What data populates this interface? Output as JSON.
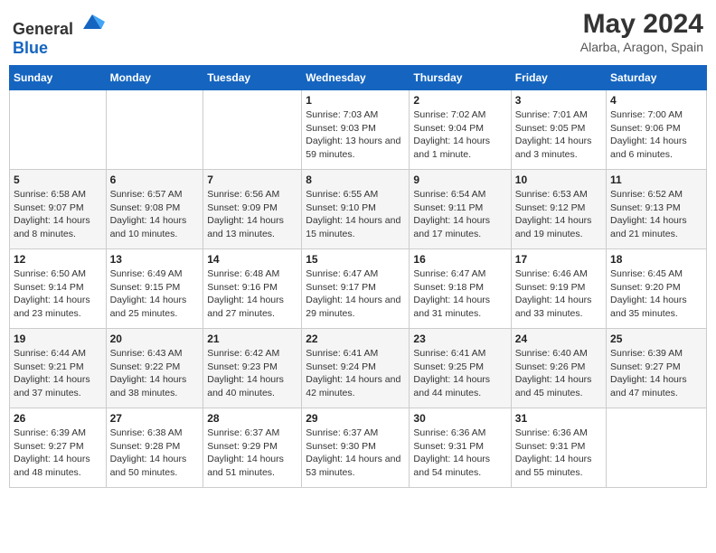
{
  "header": {
    "logo_general": "General",
    "logo_blue": "Blue",
    "month_year": "May 2024",
    "location": "Alarba, Aragon, Spain"
  },
  "days_of_week": [
    "Sunday",
    "Monday",
    "Tuesday",
    "Wednesday",
    "Thursday",
    "Friday",
    "Saturday"
  ],
  "weeks": [
    [
      {
        "num": "",
        "sunrise": "",
        "sunset": "",
        "daylight": ""
      },
      {
        "num": "",
        "sunrise": "",
        "sunset": "",
        "daylight": ""
      },
      {
        "num": "",
        "sunrise": "",
        "sunset": "",
        "daylight": ""
      },
      {
        "num": "1",
        "sunrise": "Sunrise: 7:03 AM",
        "sunset": "Sunset: 9:03 PM",
        "daylight": "Daylight: 13 hours and 59 minutes."
      },
      {
        "num": "2",
        "sunrise": "Sunrise: 7:02 AM",
        "sunset": "Sunset: 9:04 PM",
        "daylight": "Daylight: 14 hours and 1 minute."
      },
      {
        "num": "3",
        "sunrise": "Sunrise: 7:01 AM",
        "sunset": "Sunset: 9:05 PM",
        "daylight": "Daylight: 14 hours and 3 minutes."
      },
      {
        "num": "4",
        "sunrise": "Sunrise: 7:00 AM",
        "sunset": "Sunset: 9:06 PM",
        "daylight": "Daylight: 14 hours and 6 minutes."
      }
    ],
    [
      {
        "num": "5",
        "sunrise": "Sunrise: 6:58 AM",
        "sunset": "Sunset: 9:07 PM",
        "daylight": "Daylight: 14 hours and 8 minutes."
      },
      {
        "num": "6",
        "sunrise": "Sunrise: 6:57 AM",
        "sunset": "Sunset: 9:08 PM",
        "daylight": "Daylight: 14 hours and 10 minutes."
      },
      {
        "num": "7",
        "sunrise": "Sunrise: 6:56 AM",
        "sunset": "Sunset: 9:09 PM",
        "daylight": "Daylight: 14 hours and 13 minutes."
      },
      {
        "num": "8",
        "sunrise": "Sunrise: 6:55 AM",
        "sunset": "Sunset: 9:10 PM",
        "daylight": "Daylight: 14 hours and 15 minutes."
      },
      {
        "num": "9",
        "sunrise": "Sunrise: 6:54 AM",
        "sunset": "Sunset: 9:11 PM",
        "daylight": "Daylight: 14 hours and 17 minutes."
      },
      {
        "num": "10",
        "sunrise": "Sunrise: 6:53 AM",
        "sunset": "Sunset: 9:12 PM",
        "daylight": "Daylight: 14 hours and 19 minutes."
      },
      {
        "num": "11",
        "sunrise": "Sunrise: 6:52 AM",
        "sunset": "Sunset: 9:13 PM",
        "daylight": "Daylight: 14 hours and 21 minutes."
      }
    ],
    [
      {
        "num": "12",
        "sunrise": "Sunrise: 6:50 AM",
        "sunset": "Sunset: 9:14 PM",
        "daylight": "Daylight: 14 hours and 23 minutes."
      },
      {
        "num": "13",
        "sunrise": "Sunrise: 6:49 AM",
        "sunset": "Sunset: 9:15 PM",
        "daylight": "Daylight: 14 hours and 25 minutes."
      },
      {
        "num": "14",
        "sunrise": "Sunrise: 6:48 AM",
        "sunset": "Sunset: 9:16 PM",
        "daylight": "Daylight: 14 hours and 27 minutes."
      },
      {
        "num": "15",
        "sunrise": "Sunrise: 6:47 AM",
        "sunset": "Sunset: 9:17 PM",
        "daylight": "Daylight: 14 hours and 29 minutes."
      },
      {
        "num": "16",
        "sunrise": "Sunrise: 6:47 AM",
        "sunset": "Sunset: 9:18 PM",
        "daylight": "Daylight: 14 hours and 31 minutes."
      },
      {
        "num": "17",
        "sunrise": "Sunrise: 6:46 AM",
        "sunset": "Sunset: 9:19 PM",
        "daylight": "Daylight: 14 hours and 33 minutes."
      },
      {
        "num": "18",
        "sunrise": "Sunrise: 6:45 AM",
        "sunset": "Sunset: 9:20 PM",
        "daylight": "Daylight: 14 hours and 35 minutes."
      }
    ],
    [
      {
        "num": "19",
        "sunrise": "Sunrise: 6:44 AM",
        "sunset": "Sunset: 9:21 PM",
        "daylight": "Daylight: 14 hours and 37 minutes."
      },
      {
        "num": "20",
        "sunrise": "Sunrise: 6:43 AM",
        "sunset": "Sunset: 9:22 PM",
        "daylight": "Daylight: 14 hours and 38 minutes."
      },
      {
        "num": "21",
        "sunrise": "Sunrise: 6:42 AM",
        "sunset": "Sunset: 9:23 PM",
        "daylight": "Daylight: 14 hours and 40 minutes."
      },
      {
        "num": "22",
        "sunrise": "Sunrise: 6:41 AM",
        "sunset": "Sunset: 9:24 PM",
        "daylight": "Daylight: 14 hours and 42 minutes."
      },
      {
        "num": "23",
        "sunrise": "Sunrise: 6:41 AM",
        "sunset": "Sunset: 9:25 PM",
        "daylight": "Daylight: 14 hours and 44 minutes."
      },
      {
        "num": "24",
        "sunrise": "Sunrise: 6:40 AM",
        "sunset": "Sunset: 9:26 PM",
        "daylight": "Daylight: 14 hours and 45 minutes."
      },
      {
        "num": "25",
        "sunrise": "Sunrise: 6:39 AM",
        "sunset": "Sunset: 9:27 PM",
        "daylight": "Daylight: 14 hours and 47 minutes."
      }
    ],
    [
      {
        "num": "26",
        "sunrise": "Sunrise: 6:39 AM",
        "sunset": "Sunset: 9:27 PM",
        "daylight": "Daylight: 14 hours and 48 minutes."
      },
      {
        "num": "27",
        "sunrise": "Sunrise: 6:38 AM",
        "sunset": "Sunset: 9:28 PM",
        "daylight": "Daylight: 14 hours and 50 minutes."
      },
      {
        "num": "28",
        "sunrise": "Sunrise: 6:37 AM",
        "sunset": "Sunset: 9:29 PM",
        "daylight": "Daylight: 14 hours and 51 minutes."
      },
      {
        "num": "29",
        "sunrise": "Sunrise: 6:37 AM",
        "sunset": "Sunset: 9:30 PM",
        "daylight": "Daylight: 14 hours and 53 minutes."
      },
      {
        "num": "30",
        "sunrise": "Sunrise: 6:36 AM",
        "sunset": "Sunset: 9:31 PM",
        "daylight": "Daylight: 14 hours and 54 minutes."
      },
      {
        "num": "31",
        "sunrise": "Sunrise: 6:36 AM",
        "sunset": "Sunset: 9:31 PM",
        "daylight": "Daylight: 14 hours and 55 minutes."
      },
      {
        "num": "",
        "sunrise": "",
        "sunset": "",
        "daylight": ""
      }
    ]
  ]
}
